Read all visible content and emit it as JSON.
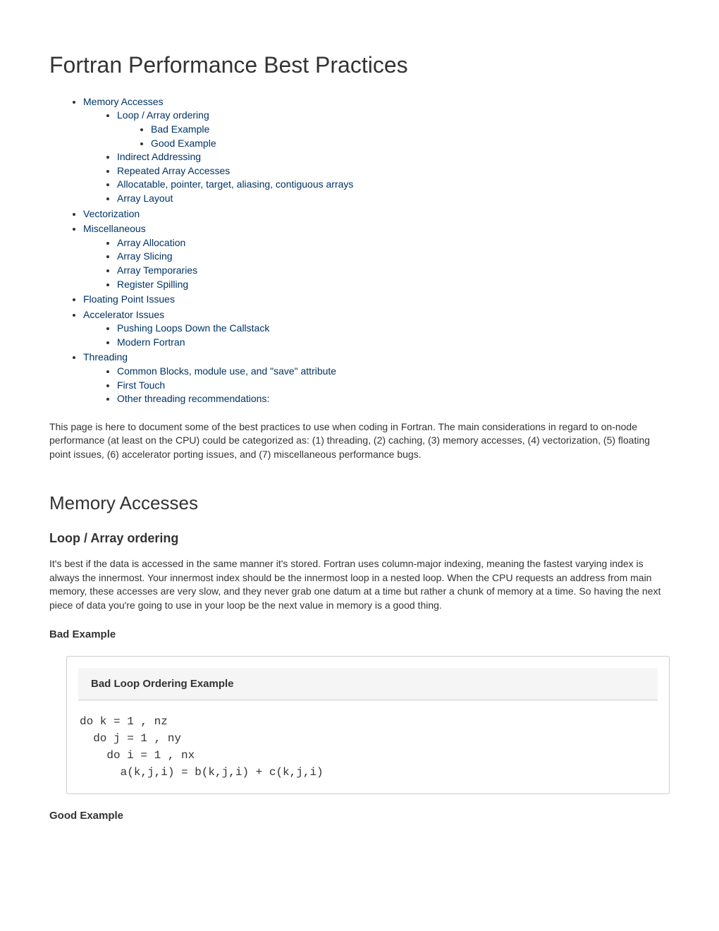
{
  "title": "Fortran Performance Best Practices",
  "toc": {
    "memory_accesses": "Memory Accesses",
    "loop_array_ordering": "Loop / Array ordering",
    "bad_example": "Bad Example",
    "good_example": "Good Example",
    "indirect_addressing": "Indirect Addressing",
    "repeated_array_accesses": "Repeated Array Accesses",
    "allocatable_pointer": "Allocatable, pointer, target, aliasing, contiguous arrays",
    "array_layout": "Array Layout",
    "vectorization": "Vectorization",
    "miscellaneous": "Miscellaneous",
    "array_allocation": "Array Allocation",
    "array_slicing": "Array Slicing",
    "array_temporaries": "Array Temporaries",
    "register_spilling": "Register Spilling",
    "floating_point_issues": "Floating Point Issues",
    "accelerator_issues": "Accelerator Issues",
    "pushing_loops": "Pushing Loops Down the Callstack",
    "modern_fortran": "Modern Fortran",
    "threading": "Threading",
    "common_blocks": "Common Blocks, module use, and \"save\" attribute",
    "first_touch": "First Touch",
    "other_threading": "Other threading recommendations:"
  },
  "intro": "This page is here to document some of the best practices to use when coding in Fortran. The main considerations in regard to on-node performance (at least on the CPU) could be categorized as: (1) threading, (2) caching, (3) memory accesses, (4) vectorization, (5) floating point issues, (6) accelerator porting issues, and (7) miscellaneous performance bugs.",
  "sections": {
    "memory_accesses_heading": "Memory Accesses",
    "loop_array_ordering_heading": "Loop / Array ordering",
    "loop_array_ordering_body": "It's best if the data is accessed in the same manner it's stored. Fortran uses column-major indexing, meaning the fastest varying index is always the innermost. Your innermost index should be the innermost loop in a nested loop. When the CPU requests an address from main memory, these accesses are very slow, and they never grab one datum at a time but rather a chunk of memory at a time. So having the next piece of data you're going to use in your loop be the next value in memory is a good thing.",
    "bad_example_heading": "Bad Example",
    "bad_panel_title": "Bad Loop Ordering Example",
    "bad_code": "do k = 1 , nz\n  do j = 1 , ny\n    do i = 1 , nx\n      a(k,j,i) = b(k,j,i) + c(k,j,i)",
    "good_example_heading": "Good Example"
  }
}
